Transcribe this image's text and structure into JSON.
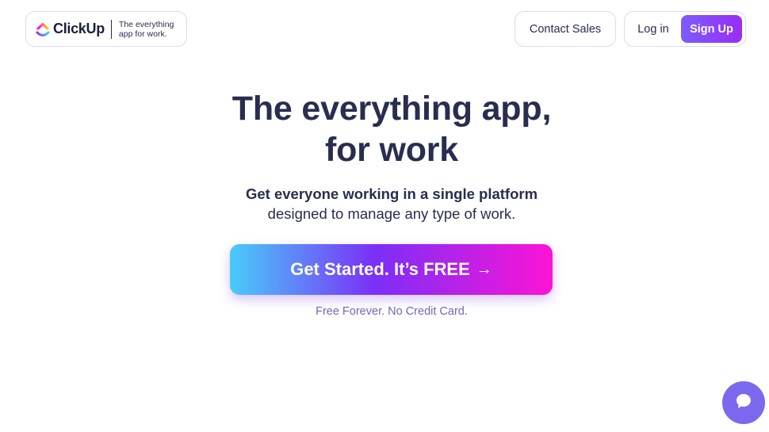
{
  "header": {
    "logo_word": "ClickUp",
    "logo_tagline": "The everything app for work.",
    "contact_label": "Contact Sales",
    "login_label": "Log in",
    "signup_label": "Sign Up"
  },
  "hero": {
    "title_line1": "The everything app,",
    "title_line2": "for work",
    "subtitle_bold": "Get everyone working in a single platform",
    "subtitle_rest": "designed to manage any type of work.",
    "cta_label": "Get Started. It’s FREE",
    "cta_arrow": "→",
    "cta_note": "Free Forever. No Credit Card."
  },
  "chat": {
    "icon": "chat-bubble-icon"
  },
  "colors": {
    "text": "#292d4f",
    "brand_purple": "#7b68ee",
    "signup_gradient_start": "#7b5cff",
    "signup_gradient_end": "#9a2cf5",
    "cta_gradient_start": "#49ccf9",
    "cta_gradient_mid": "#7b2ff7",
    "cta_gradient_end": "#fd13d6",
    "note": "#7a64b8",
    "border": "#d9dcec"
  }
}
